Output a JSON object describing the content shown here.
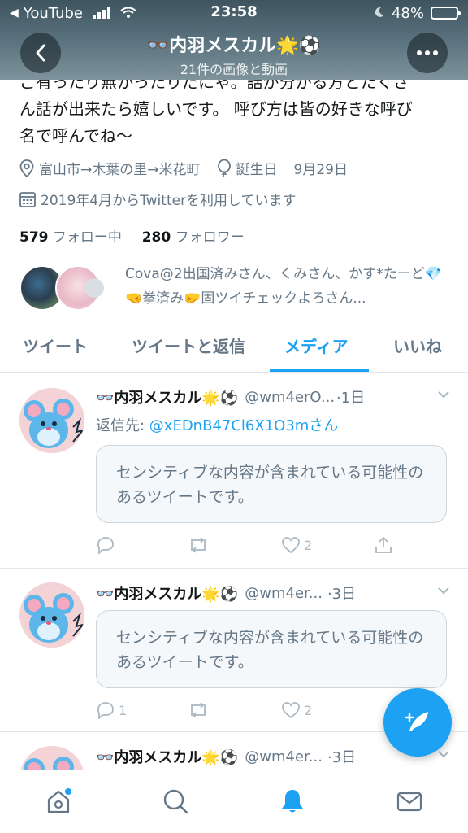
{
  "status_bar": {
    "back_app": "YouTube",
    "time": "23:58",
    "battery": "48%",
    "battery_level": 0.48
  },
  "header": {
    "name": "👓内羽メスカル🌟⚽",
    "subtitle": "21件の画像と動画"
  },
  "profile": {
    "bio_line_1": "ご有ったり無かったりだにゃ。話が分かる方とたくさ",
    "bio_line_2": "ん話が出来たら嬉しいです。 呼び方は皆の好きな呼び",
    "bio_line_3": "名で呼んでね〜",
    "location": "富山市→木葉の里→米花町",
    "birthday_label": "誕生日",
    "birthday": "9月29日",
    "joined": "2019年4月からTwitterを利用しています",
    "following_count": "579",
    "following_label": "フォロー中",
    "followers_count": "280",
    "followers_label": "フォロワー",
    "followed_by": "Cova@2出国済みさん、くみさん、かす*たーど💎🤜拳済み🤛固ツイチェックよろさん..."
  },
  "tabs": [
    "ツイート",
    "ツイートと返信",
    "メディア",
    "いいね"
  ],
  "tweets": [
    {
      "name": "👓内羽メスカル🌟⚽",
      "handle": "@wm4erO...",
      "time": "·1日",
      "reply_prefix": "返信先: ",
      "reply_to": "@xEDnB47Cl6X1O3mさん",
      "sensitive": "センシティブな内容が含まれている可能性のあるツイートです。",
      "replies": "",
      "likes": "2"
    },
    {
      "name": "👓内羽メスカル🌟⚽",
      "handle": "@wm4er...",
      "time": "·3日",
      "sensitive": "センシティブな内容が含まれている可能性のあるツイートです。",
      "replies": "1",
      "likes": "2"
    },
    {
      "name": "👓内羽メスカル🌟⚽",
      "handle": "@wm4er...",
      "time": "·3日"
    }
  ],
  "icons": {
    "back": "chevron-left-icon",
    "more": "more-dots-icon",
    "location": "location-pin-icon",
    "birthday": "balloon-icon",
    "calendar": "calendar-icon",
    "compose": "compose-feather-icon",
    "home": "home-icon",
    "search": "search-icon",
    "notifications": "bell-icon",
    "messages": "envelope-icon"
  },
  "colors": {
    "accent": "#1da1f2",
    "muted": "#657786",
    "header_bg": "#5d7580"
  }
}
